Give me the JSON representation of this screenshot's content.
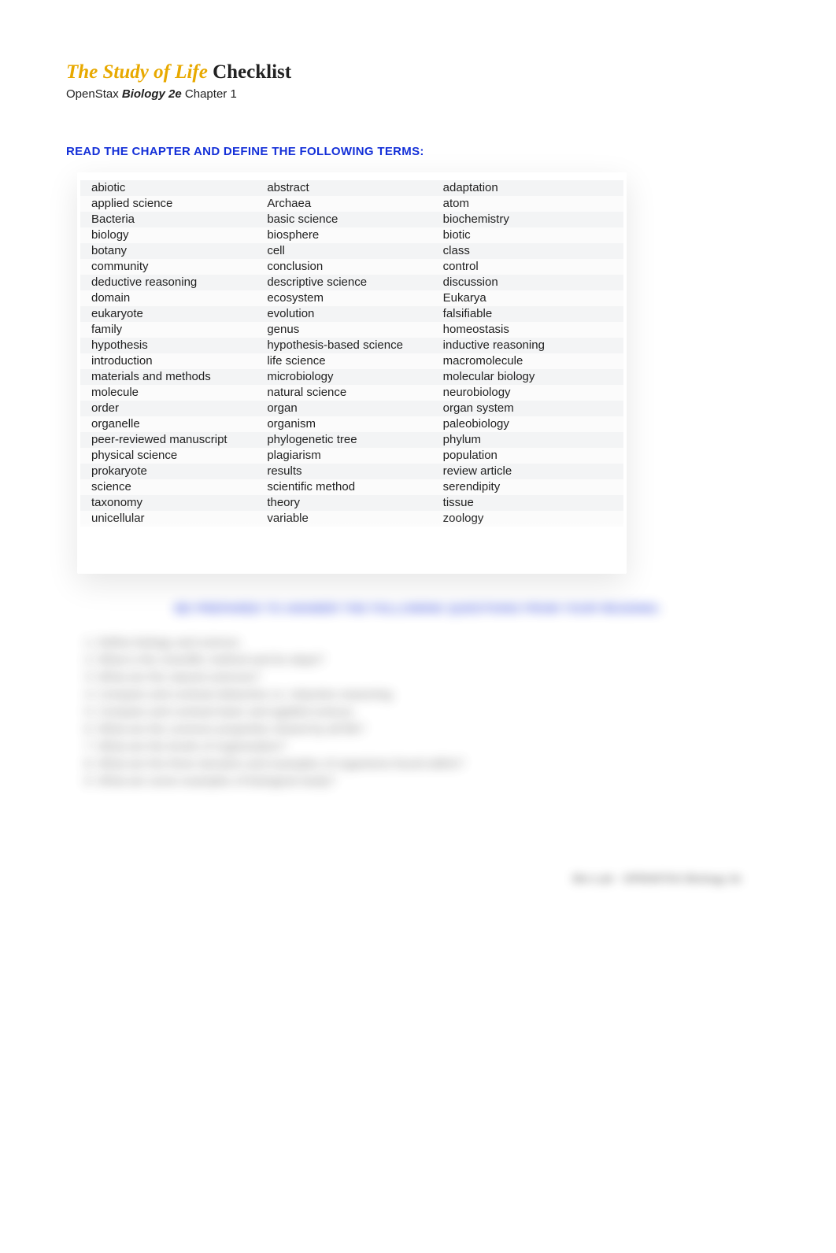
{
  "title_accent": "The Study of Life",
  "title_plain": " Checklist",
  "subtitle_pre": "OpenStax ",
  "subtitle_em": "Biology 2e",
  "subtitle_post": " Chapter 1",
  "section1_head": "READ THE CHAPTER AND DEFINE THE FOLLOWING TERMS:",
  "terms": [
    [
      "abiotic",
      "abstract",
      "adaptation"
    ],
    [
      "applied science",
      "Archaea",
      "atom"
    ],
    [
      "Bacteria",
      "basic science",
      "biochemistry"
    ],
    [
      "biology",
      "biosphere",
      "biotic"
    ],
    [
      "botany",
      "cell",
      "class"
    ],
    [
      "community",
      "conclusion",
      "control"
    ],
    [
      "deductive reasoning",
      "descriptive science",
      "discussion"
    ],
    [
      "domain",
      "ecosystem",
      "Eukarya"
    ],
    [
      "eukaryote",
      "evolution",
      "falsifiable"
    ],
    [
      "family",
      "genus",
      "homeostasis"
    ],
    [
      "hypothesis",
      "hypothesis-based science",
      "inductive reasoning"
    ],
    [
      "introduction",
      "life science",
      "macromolecule"
    ],
    [
      "materials and methods",
      "microbiology",
      "molecular biology"
    ],
    [
      "molecule",
      "natural science",
      "neurobiology"
    ],
    [
      "order",
      "organ",
      "organ system"
    ],
    [
      "organelle",
      "organism",
      "paleobiology"
    ],
    [
      "peer-reviewed manuscript",
      "phylogenetic tree",
      "phylum"
    ],
    [
      "physical science",
      "plagiarism",
      "population"
    ],
    [
      "prokaryote",
      "results",
      "review article"
    ],
    [
      "science",
      "scientific method",
      "serendipity"
    ],
    [
      "taxonomy",
      "theory",
      "tissue"
    ],
    [
      "unicellular",
      "variable",
      "zoology"
    ]
  ],
  "blur_head": "BE PREPARED TO ANSWER THE FOLLOWING QUESTIONS FROM YOUR READING:",
  "blur_items": [
    "Define biology and science.",
    "What is the scientific method and its steps?",
    "What are the natural sciences?",
    "Compare and contrast deductive vs. inductive reasoning.",
    "Compare and contrast basic and applied science.",
    "What are the common properties shared by all life?",
    "What are the levels of organization?",
    "What are the three domains and examples of organisms found within?",
    "What are some examples of biological study?"
  ],
  "footer": "Bio Lab · OPENSTAX Biology 2e"
}
